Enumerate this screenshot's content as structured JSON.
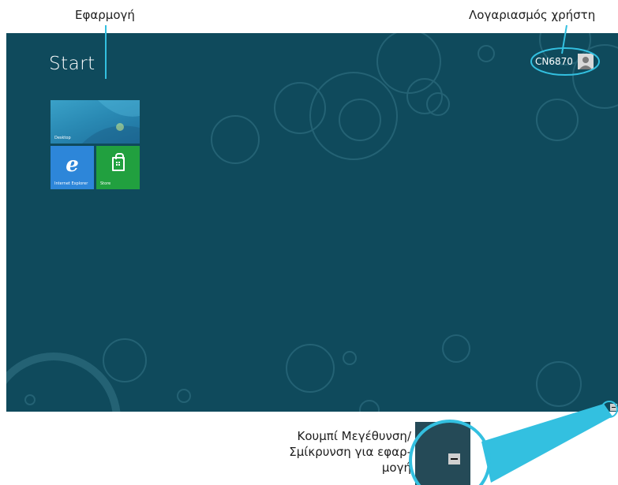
{
  "callouts": {
    "app": "Εφαρμογή",
    "account": "Λογαριασμός χρήστη",
    "zoom_line1": "Κουμπί Μεγέθυνση/",
    "zoom_line2": "Σμίκρυνση για εφαρ-",
    "zoom_line3": "μογή"
  },
  "start_screen": {
    "title": "Start",
    "background_color": "#0f4a5c",
    "user": {
      "name": "CN6870",
      "avatar_icon": "user-avatar-icon"
    },
    "tiles": [
      {
        "label": "Desktop",
        "color": "#2a8ab4"
      },
      {
        "label": "Internet Explorer",
        "color": "#2d86d9",
        "icon": "internet-explorer-icon"
      },
      {
        "label": "Store",
        "color": "#21a03f",
        "icon": "store-bag-icon"
      }
    ],
    "zoom_button_icon": "minus-icon"
  },
  "colors": {
    "callout_line": "#33c0e0"
  }
}
